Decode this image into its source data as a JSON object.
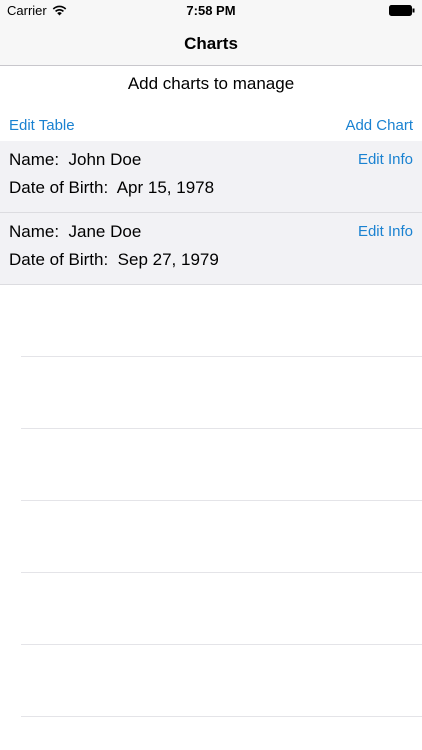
{
  "status_bar": {
    "carrier": "Carrier",
    "time": "7:58 PM",
    "wifi_icon": "wifi-icon",
    "battery_icon": "battery-icon"
  },
  "nav": {
    "title": "Charts"
  },
  "subtitle": "Add charts to manage",
  "toolbar": {
    "edit_table": "Edit Table",
    "add_chart": "Add Chart"
  },
  "colors": {
    "link": "#1a82d1",
    "row_background": "#f2f2f5",
    "bar_background": "#f7f7f7"
  },
  "charts": [
    {
      "name_label": "Name:  John Doe",
      "dob_label": "Date of Birth:  Apr 15, 1978",
      "edit_label": "Edit Info"
    },
    {
      "name_label": "Name:  Jane Doe",
      "dob_label": "Date of Birth:  Sep 27, 1979",
      "edit_label": "Edit Info"
    }
  ]
}
